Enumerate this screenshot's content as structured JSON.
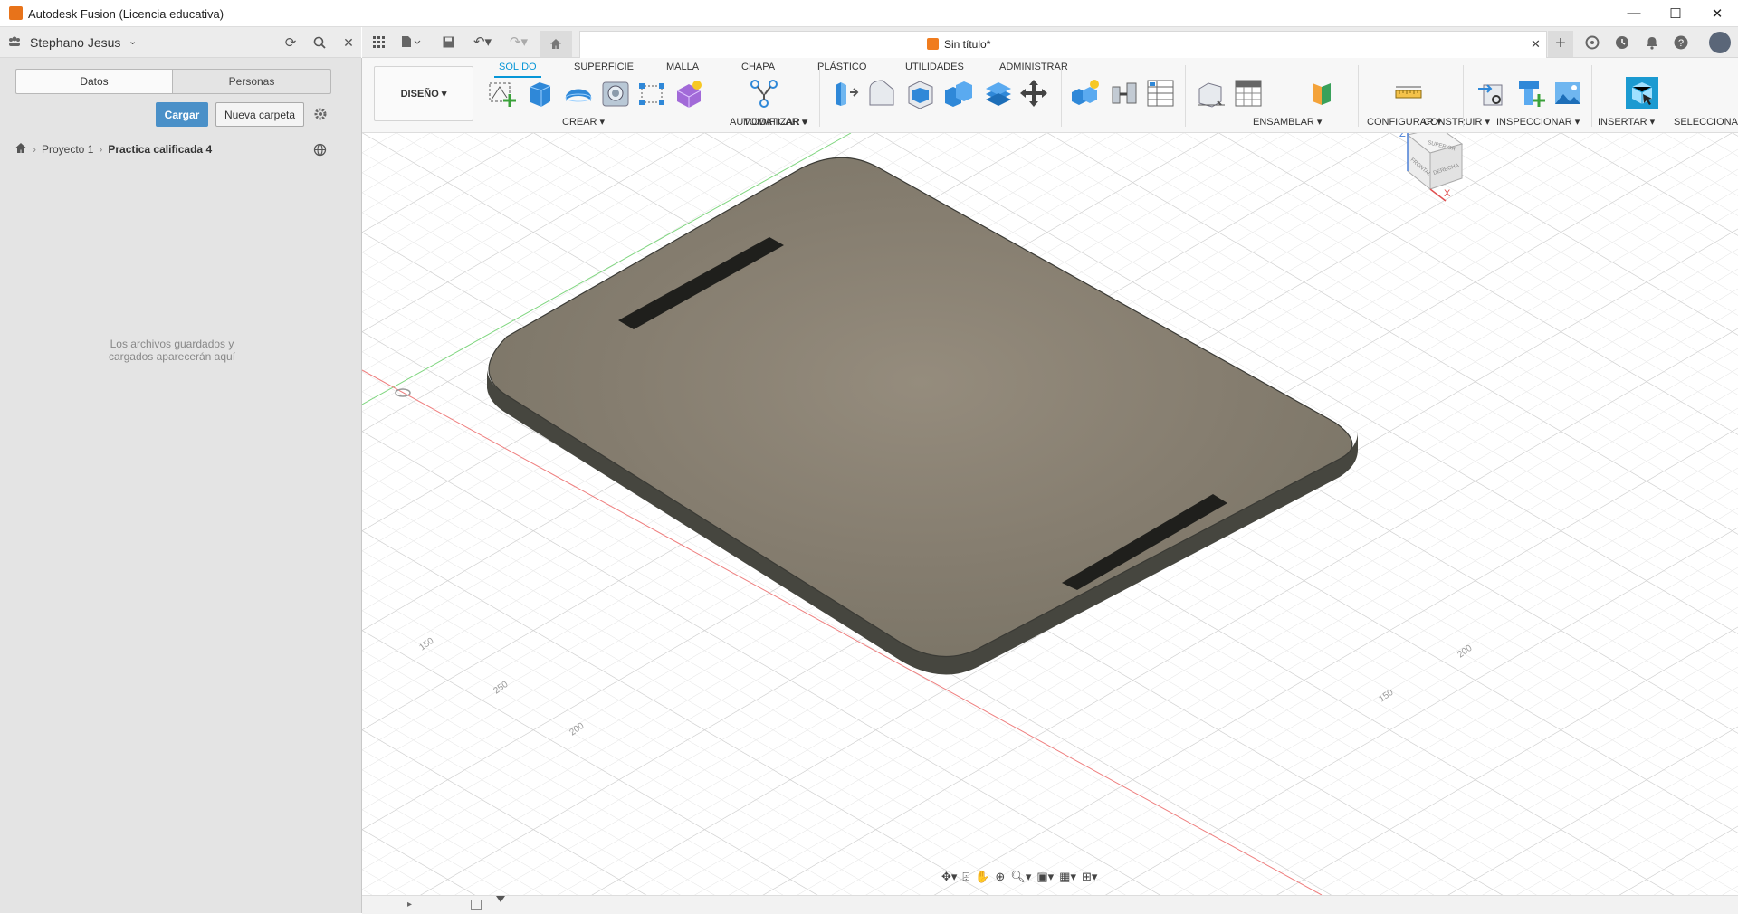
{
  "window": {
    "title": "Autodesk Fusion (Licencia educativa)",
    "minimize": "—",
    "maximize": "☐",
    "close": "✕"
  },
  "user": {
    "name": "Stephano Jesus"
  },
  "document": {
    "tab_title": "Sin título*"
  },
  "panel": {
    "tabs": [
      "Datos",
      "Personas"
    ],
    "upload_label": "Cargar",
    "new_folder_label": "Nueva carpeta",
    "breadcrumb": [
      "Proyecto 1",
      "Practica calificada 4"
    ],
    "empty_message_1": "Los archivos guardados y",
    "empty_message_2": "cargados aparecerán aquí"
  },
  "workspace": {
    "label": "DISEÑO ▾"
  },
  "toolbar": {
    "tabs": [
      "SOLIDO",
      "SUPERFICIE",
      "MALLA",
      "CHAPA",
      "PLÁSTICO",
      "UTILIDADES",
      "ADMINISTRAR"
    ],
    "active_tab": "SOLIDO",
    "groups": [
      "CREAR ▾",
      "AUTOMATIZAR ▾",
      "MODIFICAR ▾",
      "ENSAMBLAR ▾",
      "CONFIGURAR ▾",
      "CONSTRUIR ▾",
      "INSPECCIONAR ▾",
      "INSERTAR ▾",
      "SELECCIONAR ▾"
    ]
  },
  "viewcube": {
    "top": "SUPERIOR",
    "front": "FRONTAL",
    "right": "DERECHA",
    "axis_z": "Z",
    "axis_x": "X"
  },
  "grid_labels": [
    "150",
    "200",
    "250",
    "200",
    "150"
  ],
  "colors": {
    "accent": "#0696d7",
    "button_blue": "#4a90c8",
    "part": "#8a8172",
    "side": "#4a4a44"
  }
}
